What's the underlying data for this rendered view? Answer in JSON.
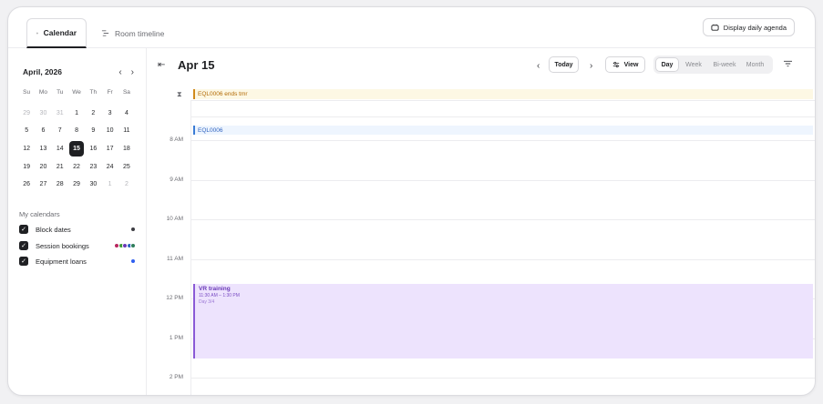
{
  "tabs": [
    {
      "label": "Calendar",
      "icon": "calendar-icon"
    },
    {
      "label": "Room timeline",
      "icon": "timeline-icon"
    }
  ],
  "agenda_button": "Display daily agenda",
  "mini_calendar": {
    "title": "April, 2026",
    "weekdays": [
      "Su",
      "Mo",
      "Tu",
      "We",
      "Th",
      "Fr",
      "Sa"
    ],
    "weeks": [
      [
        "29",
        "30",
        "31",
        "1",
        "2",
        "3",
        "4"
      ],
      [
        "5",
        "6",
        "7",
        "8",
        "9",
        "10",
        "11"
      ],
      [
        "12",
        "13",
        "14",
        "15",
        "16",
        "17",
        "18"
      ],
      [
        "19",
        "20",
        "21",
        "22",
        "23",
        "24",
        "25"
      ],
      [
        "26",
        "27",
        "28",
        "29",
        "30",
        "1",
        "2"
      ]
    ],
    "selected": "15"
  },
  "my_calendars": {
    "title": "My calendars",
    "items": [
      {
        "label": "Block dates",
        "colors": [
          "#3d3d42"
        ]
      },
      {
        "label": "Session bookings",
        "colors": [
          "#b8265e",
          "#3e9a3a",
          "#6a38b8",
          "#2f63c0",
          "#2e7d5b"
        ]
      },
      {
        "label": "Equipment loans",
        "colors": [
          "#2f5ff0"
        ]
      }
    ]
  },
  "header": {
    "date": "Apr 15",
    "today": "Today",
    "view": "View",
    "views": [
      "Day",
      "Week",
      "Bi-week",
      "Month"
    ],
    "active_view": "Day"
  },
  "allday_event": "EQL0006 ends tmr",
  "timed_top_event": "EQL0006",
  "hours": [
    "8 AM",
    "9 AM",
    "10 AM",
    "11 AM",
    "12 PM",
    "1 PM",
    "2 PM"
  ],
  "event": {
    "title": "VR training",
    "time": "11:30 AM – 1:30 PM",
    "day": "Day 3/4"
  },
  "colors": {
    "accent": "#1f2023",
    "allday_bg": "#fdf8e4",
    "event_bg": "#ede3fd",
    "event_border": "#8a5ad6"
  }
}
